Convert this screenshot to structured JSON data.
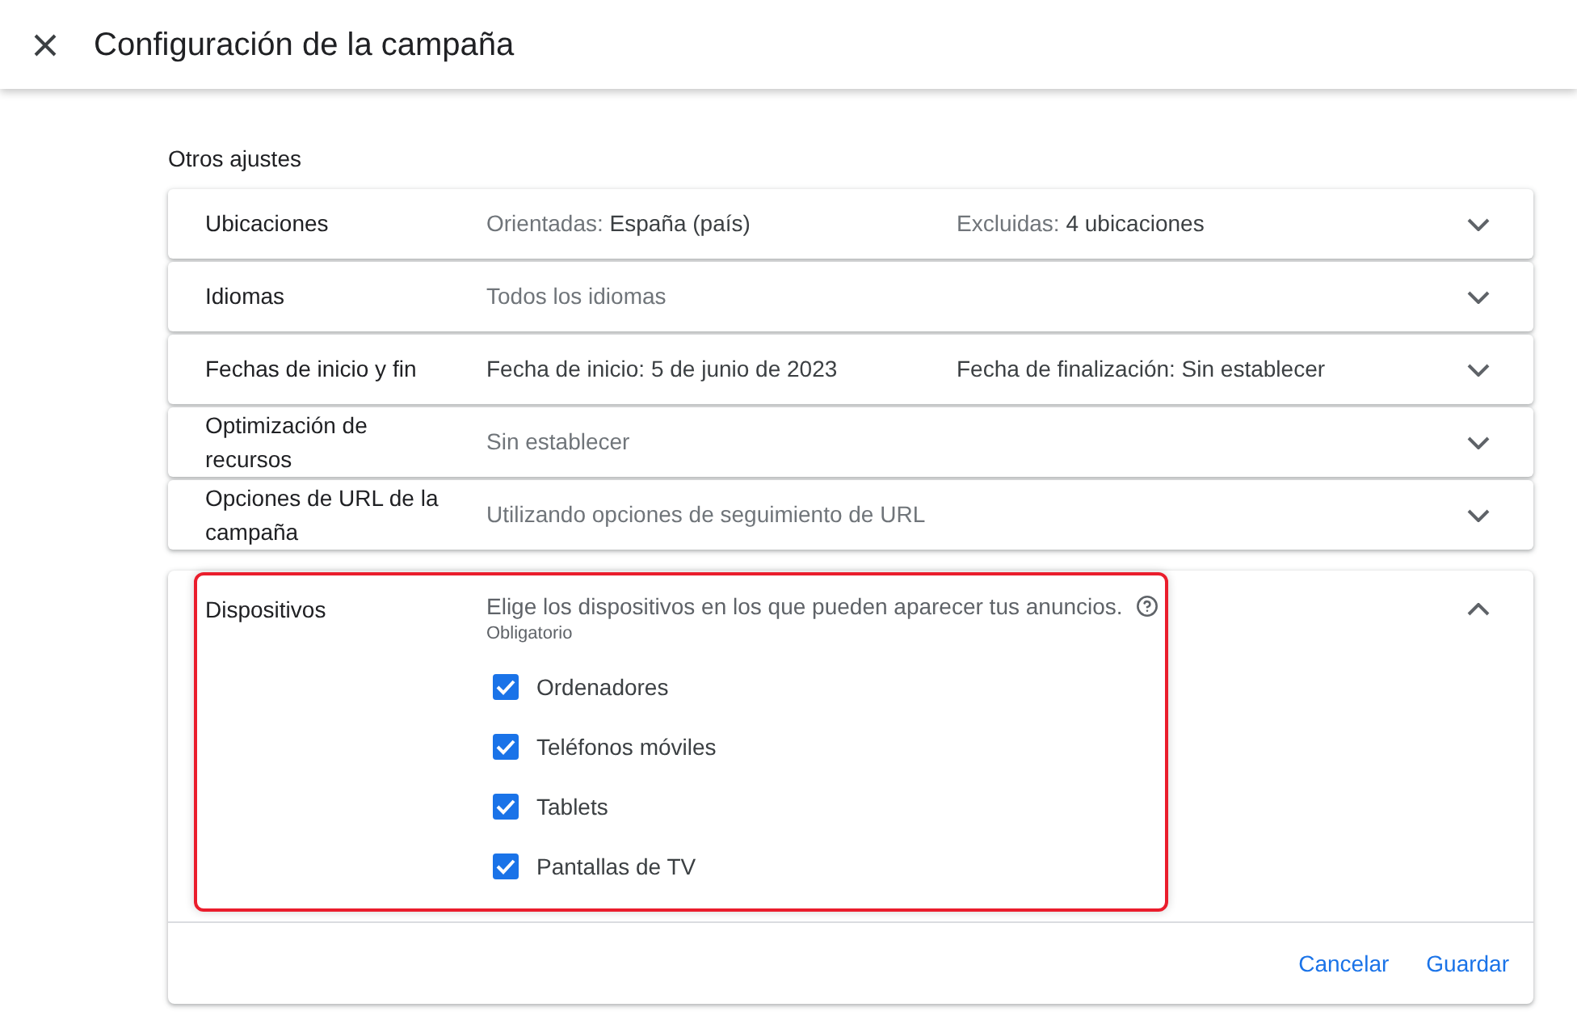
{
  "header": {
    "title": "Configuración de la campaña"
  },
  "section": {
    "title": "Otros ajustes"
  },
  "settings": [
    {
      "label": "Ubicaciones",
      "expanded": false,
      "summaries": [
        {
          "parts": [
            {
              "text": "Orientadas:",
              "emphasized": false
            },
            {
              "text": "España (país)",
              "emphasized": true
            }
          ]
        },
        {
          "parts": [
            {
              "text": "Excluidas:",
              "emphasized": false
            },
            {
              "text": "4 ubicaciones",
              "emphasized": true
            }
          ]
        }
      ]
    },
    {
      "label": "Idiomas",
      "expanded": false,
      "summaries": [
        {
          "parts": [
            {
              "text": "Todos los idiomas",
              "emphasized": false
            }
          ]
        }
      ]
    },
    {
      "label": "Fechas de inicio y fin",
      "expanded": false,
      "summaries": [
        {
          "parts": [
            {
              "text": "Fecha de inicio: 5 de junio de 2023",
              "emphasized": true
            }
          ]
        },
        {
          "parts": [
            {
              "text": "Fecha de finalización: Sin establecer",
              "emphasized": true
            }
          ]
        }
      ]
    },
    {
      "label": "Optimización de recursos",
      "expanded": false,
      "summaries": [
        {
          "parts": [
            {
              "text": "Sin establecer",
              "emphasized": false
            }
          ]
        }
      ]
    },
    {
      "label": "Opciones de URL de la campaña",
      "expanded": false,
      "summaries": [
        {
          "parts": [
            {
              "text": "Utilizando opciones de seguimiento de URL",
              "emphasized": false
            }
          ]
        }
      ]
    }
  ],
  "devices": {
    "label": "Dispositivos",
    "expanded": true,
    "highlighted": true,
    "description": "Elige los dispositivos en los que pueden aparecer tus anuncios.",
    "required_note": "Obligatorio",
    "options": [
      {
        "label": "Ordenadores",
        "checked": true
      },
      {
        "label": "Teléfonos móviles",
        "checked": true
      },
      {
        "label": "Tablets",
        "checked": true
      },
      {
        "label": "Pantallas de TV",
        "checked": true
      }
    ],
    "buttons": [
      {
        "label": "Cancelar"
      },
      {
        "label": "Guardar"
      }
    ]
  }
}
